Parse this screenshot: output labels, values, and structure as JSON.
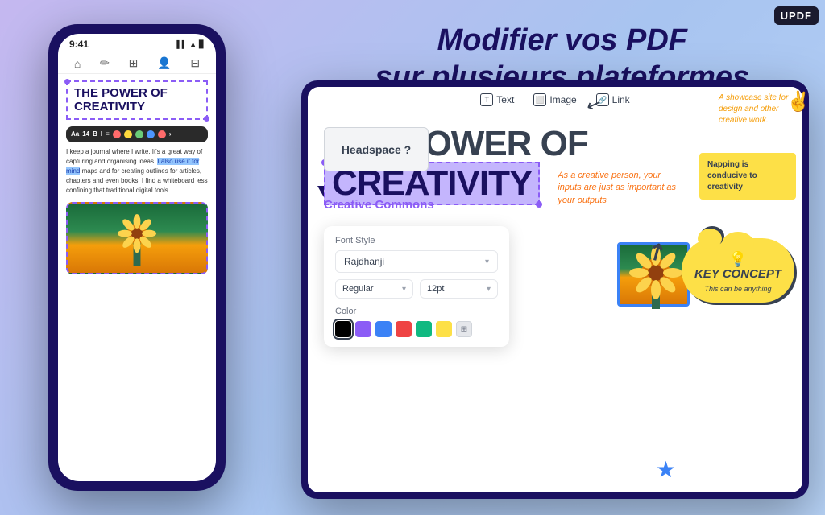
{
  "app": {
    "logo": "UPDF",
    "background_gradient": "linear-gradient(135deg, #c5b8f0 0%, #a8c4f0 50%, #b8d4f8 100%)"
  },
  "header": {
    "line1": "Modifier vos PDF",
    "line2": "sur plusieurs plateformes"
  },
  "phone": {
    "time": "9:41",
    "signal_icons": "▌▌ ▲ ▊",
    "toolbar_icons": [
      "⌂",
      "✏",
      "⊞",
      "👤",
      "⊟"
    ],
    "title_line1": "THE POWER OF",
    "title_line2": "CREATIVITY",
    "format_font": "Aa",
    "format_size": "14",
    "format_bold": "B",
    "format_italic": "I",
    "body_text_1": "I keep a journal where I write. It's a great way of capturing and organising ideas.",
    "highlight_text": "I also use it for mind",
    "body_text_2": "maps and for creating outlines for articles, chapters and even books. I find a whiteboard less confining that traditional digital tools."
  },
  "tablet": {
    "toolbar": {
      "items": [
        {
          "icon": "T",
          "label": "Text"
        },
        {
          "icon": "⬜",
          "label": "Image"
        },
        {
          "icon": "🔗",
          "label": "Link"
        }
      ]
    },
    "title_line1": "THE POWER OF",
    "title_line2": "CREATIVITY",
    "italic_text": "As a creative person, your inputs are just as important as your outputs",
    "creative_deco": "A showcase site for design and other creative work."
  },
  "font_panel": {
    "style_label": "Font Style",
    "font_name": "Rajdhanji",
    "weight": "Regular",
    "size": "12pt",
    "color_label": "Color",
    "colors": [
      "#000000",
      "#8b5cf6",
      "#3b82f6",
      "#ef4444",
      "#10b981",
      "#fde047",
      "#6b7280"
    ]
  },
  "decorations": {
    "hand_emoji": "✌️",
    "key_concept_title": "KEY CONCEPT",
    "key_concept_sub": "This can be anything",
    "bulb": "💡",
    "headspace_text": "Headspace ?",
    "napping_text": "Napping is conducive to creativity",
    "creative_commons": "Creative Commons"
  },
  "arrows": {
    "arrow1": "↗",
    "arrow2": "↙"
  }
}
